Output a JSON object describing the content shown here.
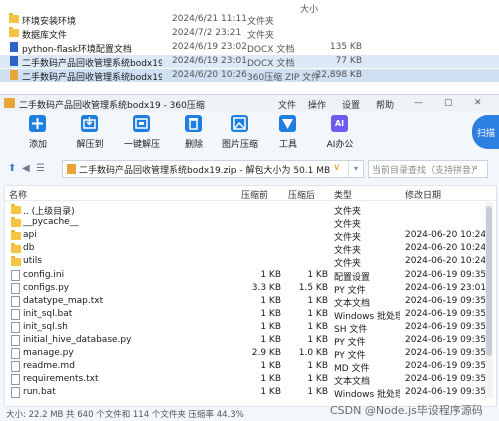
{
  "explorer": {
    "header": {
      "date_col": "",
      "size_col": "大小"
    },
    "rows": [
      {
        "name": "环境安装环境",
        "date": "2024/6/21 11:11",
        "type": "文件夹",
        "size": "",
        "icon": "folder-icon"
      },
      {
        "name": "数据库文件",
        "date": "2024/7/2 23:21",
        "type": "文件夹",
        "size": "",
        "icon": "folder-icon"
      },
      {
        "name": "python-flask环境配置文档",
        "date": "2024/6/19 23:02",
        "type": "DOCX 文档",
        "size": "135 KB",
        "icon": "docx-icon"
      },
      {
        "name": "二手数码产品回收管理系统bodx19",
        "date": "2024/6/19 23:01",
        "type": "DOCX 文档",
        "size": "77 KB",
        "icon": "docx-icon"
      },
      {
        "name": "二手数码产品回收管理系统bodx19",
        "date": "2024/6/20 10:26",
        "type": "360压缩 ZIP 文件",
        "size": "22,898 KB",
        "icon": "zip-icon"
      }
    ]
  },
  "zip_window": {
    "title": "二手数码产品回收管理系统bodx19 - 360压缩",
    "menu": [
      "文件",
      "操作",
      "设置",
      "帮助"
    ],
    "toolbar": [
      {
        "label": "添加",
        "icon": "add-icon",
        "color": "#1e7fe0"
      },
      {
        "label": "解压到",
        "icon": "extract-to-icon",
        "color": "#1e7fe0"
      },
      {
        "label": "一键解压",
        "icon": "one-click-extract-icon",
        "color": "#1e7fe0"
      },
      {
        "label": "删除",
        "icon": "delete-icon",
        "color": "#1e7fe0"
      },
      {
        "label": "图片压缩",
        "icon": "image-compress-icon",
        "color": "#1e7fe0"
      },
      {
        "label": "工具",
        "icon": "tools-icon",
        "color": "#1e7fe0"
      },
      {
        "label": "AI办公",
        "icon": "ai-office-icon",
        "color": "#6b5cf0"
      }
    ],
    "scan_label": "扫描",
    "address": "二手数码产品回收管理系统bodx19.zip - 解包大小为 50.1 MB",
    "search_placeholder": "当前目录查找（支持拼音）",
    "columns": {
      "name": "名称",
      "size": "压缩前",
      "csize": "压缩后",
      "type": "类型",
      "date": "修改日期"
    },
    "files": [
      {
        "name": ".. (上级目录)",
        "size": "",
        "csize": "",
        "type": "文件夹",
        "date": "",
        "icon": "folder-icon"
      },
      {
        "name": "__pycache__",
        "size": "",
        "csize": "",
        "type": "文件夹",
        "date": "",
        "icon": "folder-icon"
      },
      {
        "name": "api",
        "size": "",
        "csize": "",
        "type": "文件夹",
        "date": "2024-06-20 10:24",
        "icon": "folder-icon"
      },
      {
        "name": "db",
        "size": "",
        "csize": "",
        "type": "文件夹",
        "date": "2024-06-20 10:24",
        "icon": "folder-icon"
      },
      {
        "name": "utils",
        "size": "",
        "csize": "",
        "type": "文件夹",
        "date": "2024-06-20 10:24",
        "icon": "folder-icon"
      },
      {
        "name": "config.ini",
        "size": "1 KB",
        "csize": "1 KB",
        "type": "配置设置",
        "date": "2024-06-19 09:35",
        "icon": "file-icon"
      },
      {
        "name": "configs.py",
        "size": "3.3 KB",
        "csize": "1.5 KB",
        "type": "PY 文件",
        "date": "2024-06-19 23:01",
        "icon": "file-icon"
      },
      {
        "name": "datatype_map.txt",
        "size": "1 KB",
        "csize": "1 KB",
        "type": "文本文档",
        "date": "2024-06-19 09:35",
        "icon": "file-icon"
      },
      {
        "name": "init_sql.bat",
        "size": "1 KB",
        "csize": "1 KB",
        "type": "Windows 批处理...",
        "date": "2024-06-19 09:35",
        "icon": "file-icon"
      },
      {
        "name": "init_sql.sh",
        "size": "1 KB",
        "csize": "1 KB",
        "type": "SH 文件",
        "date": "2024-06-19 09:35",
        "icon": "file-icon"
      },
      {
        "name": "initial_hive_database.py",
        "size": "1 KB",
        "csize": "1 KB",
        "type": "PY 文件",
        "date": "2024-06-19 09:35",
        "icon": "file-icon"
      },
      {
        "name": "manage.py",
        "size": "2.9 KB",
        "csize": "1.0 KB",
        "type": "PY 文件",
        "date": "2024-06-19 09:35",
        "icon": "file-icon"
      },
      {
        "name": "readme.md",
        "size": "1 KB",
        "csize": "1 KB",
        "type": "MD 文件",
        "date": "2024-06-19 09:35",
        "icon": "file-icon"
      },
      {
        "name": "requirements.txt",
        "size": "1 KB",
        "csize": "1 KB",
        "type": "文本文档",
        "date": "2024-06-19 09:35",
        "icon": "file-icon"
      },
      {
        "name": "run.bat",
        "size": "1 KB",
        "csize": "1 KB",
        "type": "Windows 批处理...",
        "date": "2024-06-19 09:35",
        "icon": "file-icon"
      }
    ],
    "status": "大小: 22.2 MB 共 640 个文件和 114 个文件夹 压缩率 44.3%"
  },
  "watermark": "CSDN @Node.js毕设程序源码"
}
